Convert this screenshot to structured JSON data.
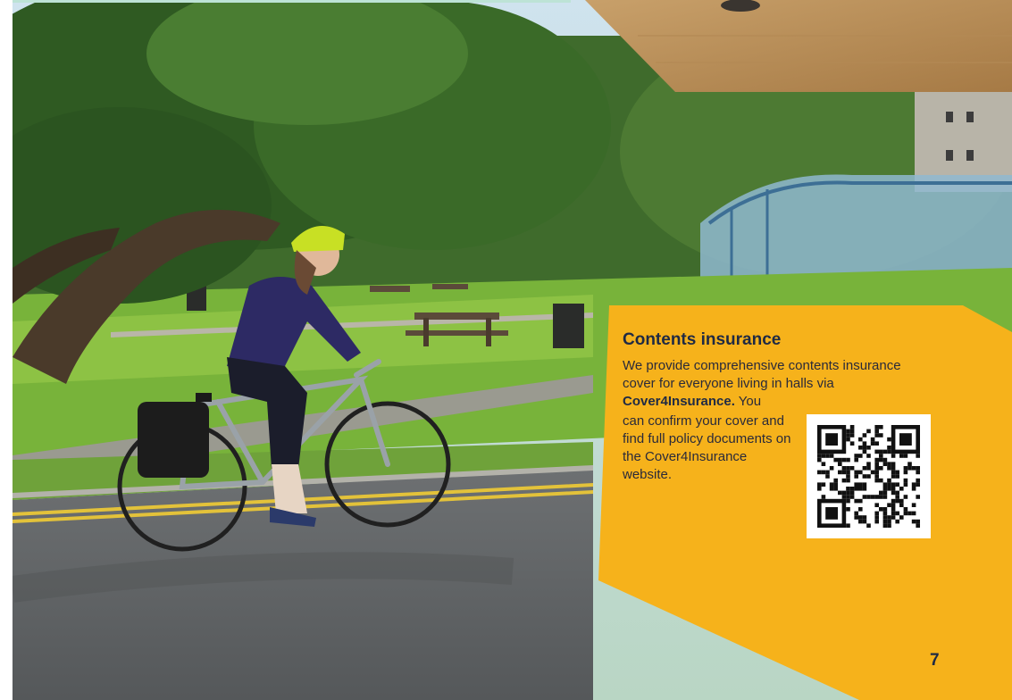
{
  "section": {
    "heading": "Contents insurance",
    "intro_before": "We provide comprehensive contents insurance cover for everyone living in halls via ",
    "provider_name": "Cover4Insurance.",
    "intro_after": " You",
    "side_text": "can confirm your cover and find full policy documents on the Cover4Insurance website."
  },
  "qr_code": {
    "icon": "qr-code-icon"
  },
  "page_number": "7",
  "colors": {
    "accent": "#f6b21b",
    "heading": "#1f2a44",
    "body_text": "#2a2a3a"
  }
}
